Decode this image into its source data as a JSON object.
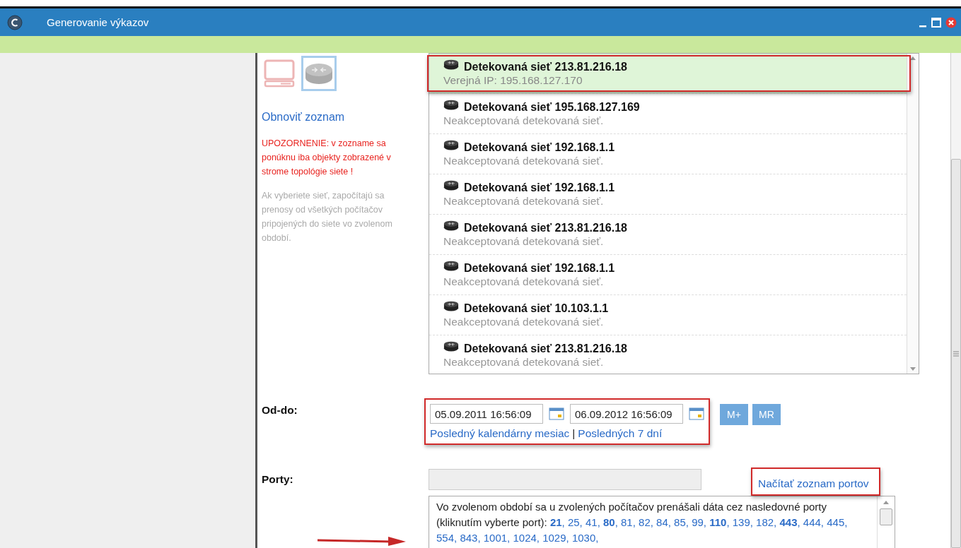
{
  "window": {
    "title": "Generovanie výkazov"
  },
  "object_types": [
    {
      "kind": "computer",
      "selected": false
    },
    {
      "kind": "network",
      "selected": true
    }
  ],
  "refresh_link": "Obnoviť zoznam",
  "warning": "UPOZORNENIE: v zozname sa ponúknu iba objekty zobrazené v strome topológie siete !",
  "info": "Ak vyberiete sieť, započítajú sa prenosy od všetkých počítačov pripojených do siete vo zvolenom období.",
  "networks": [
    {
      "title": "Detekovaná sieť 213.81.216.18",
      "subtitle": "Verejná IP: 195.168.127.170",
      "selected": true
    },
    {
      "title": "Detekovaná sieť 195.168.127.169",
      "subtitle": "Neakceptovaná detekovaná sieť.",
      "selected": false
    },
    {
      "title": "Detekovaná sieť 192.168.1.1",
      "subtitle": "Neakceptovaná detekovaná sieť.",
      "selected": false
    },
    {
      "title": "Detekovaná sieť 192.168.1.1",
      "subtitle": "Neakceptovaná detekovaná sieť.",
      "selected": false
    },
    {
      "title": "Detekovaná sieť 213.81.216.18",
      "subtitle": "Neakceptovaná detekovaná sieť.",
      "selected": false
    },
    {
      "title": "Detekovaná sieť 192.168.1.1",
      "subtitle": "Neakceptovaná detekovaná sieť.",
      "selected": false
    },
    {
      "title": "Detekovaná sieť 10.103.1.1",
      "subtitle": "Neakceptovaná detekovaná sieť.",
      "selected": false
    },
    {
      "title": "Detekovaná sieť 213.81.216.18",
      "subtitle": "Neakceptovaná detekovaná sieť.",
      "selected": false
    }
  ],
  "period": {
    "label": "Od-do:",
    "from": "05.09.2011 16:56:09",
    "to": "06.09.2012 16:56:09",
    "buttons": [
      "M+",
      "MR"
    ],
    "links": [
      "Posledný kalendárny mesiac",
      "|",
      "Posledných 7 dní"
    ]
  },
  "ports": {
    "label": "Porty:",
    "load_link": "Načítať zoznam portov",
    "intro": "Vo zvolenom období sa u zvolených počítačov prenášali dáta cez nasledovné porty (kliknutím vyberte port):",
    "items": [
      "**21**,",
      "25,",
      "41,",
      "**80**,",
      "81,",
      "82,",
      "84,",
      "85,",
      "99,",
      "**110**,",
      "139,",
      "182,",
      "**443**,",
      "444,",
      "445,",
      "554,",
      "843,",
      "1001,",
      "1024,",
      "1029,",
      "1030,"
    ]
  }
}
